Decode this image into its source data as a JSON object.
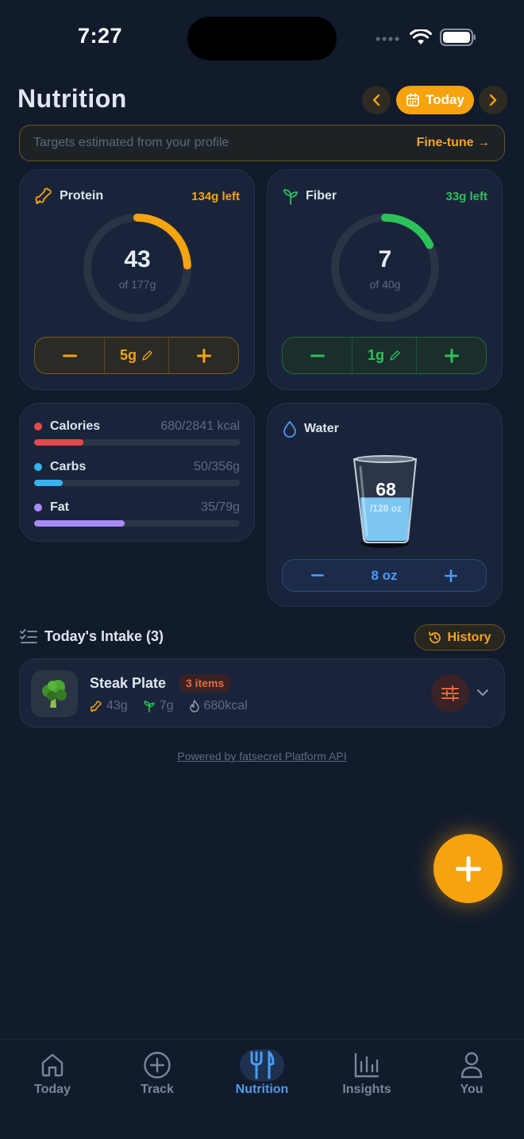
{
  "status_bar": {
    "time": "7:27"
  },
  "header": {
    "title": "Nutrition",
    "date_label": "Today"
  },
  "banner": {
    "text": "Targets estimated from your profile",
    "action": "Fine-tune →"
  },
  "protein": {
    "name": "Protein",
    "left": "134g left",
    "value": "43",
    "target": "of 177g",
    "progress": 0.243,
    "step": "5g",
    "color": "#f5a30f"
  },
  "fiber": {
    "name": "Fiber",
    "left": "33g left",
    "value": "7",
    "target": "of 40g",
    "progress": 0.175,
    "step": "1g",
    "color": "#2bc25a"
  },
  "macros": [
    {
      "label": "Calories",
      "value": "680/2841 kcal",
      "progress": 0.24,
      "color": "#e5484d"
    },
    {
      "label": "Carbs",
      "value": "50/356g",
      "progress": 0.14,
      "color": "#38b2f0"
    },
    {
      "label": "Fat",
      "value": "35/79g",
      "progress": 0.44,
      "color": "#a78bfa"
    }
  ],
  "water": {
    "name": "Water",
    "value": "68",
    "target": "/128 oz",
    "progress": 0.53,
    "step": "8 oz"
  },
  "intake": {
    "title": "Today's Intake (3)",
    "history_label": "History",
    "items": [
      {
        "name": "Steak Plate",
        "badge": "3 items",
        "protein": "43g",
        "fiber": "7g",
        "calories": "680kcal"
      }
    ]
  },
  "footer": {
    "powered_by": "Powered by fatsecret Platform API"
  },
  "tabs": [
    {
      "label": "Today",
      "icon": "home-icon"
    },
    {
      "label": "Track",
      "icon": "plus-circle-icon"
    },
    {
      "label": "Nutrition",
      "icon": "fork-knife-icon",
      "active": true
    },
    {
      "label": "Insights",
      "icon": "bar-chart-icon"
    },
    {
      "label": "You",
      "icon": "person-icon"
    }
  ]
}
